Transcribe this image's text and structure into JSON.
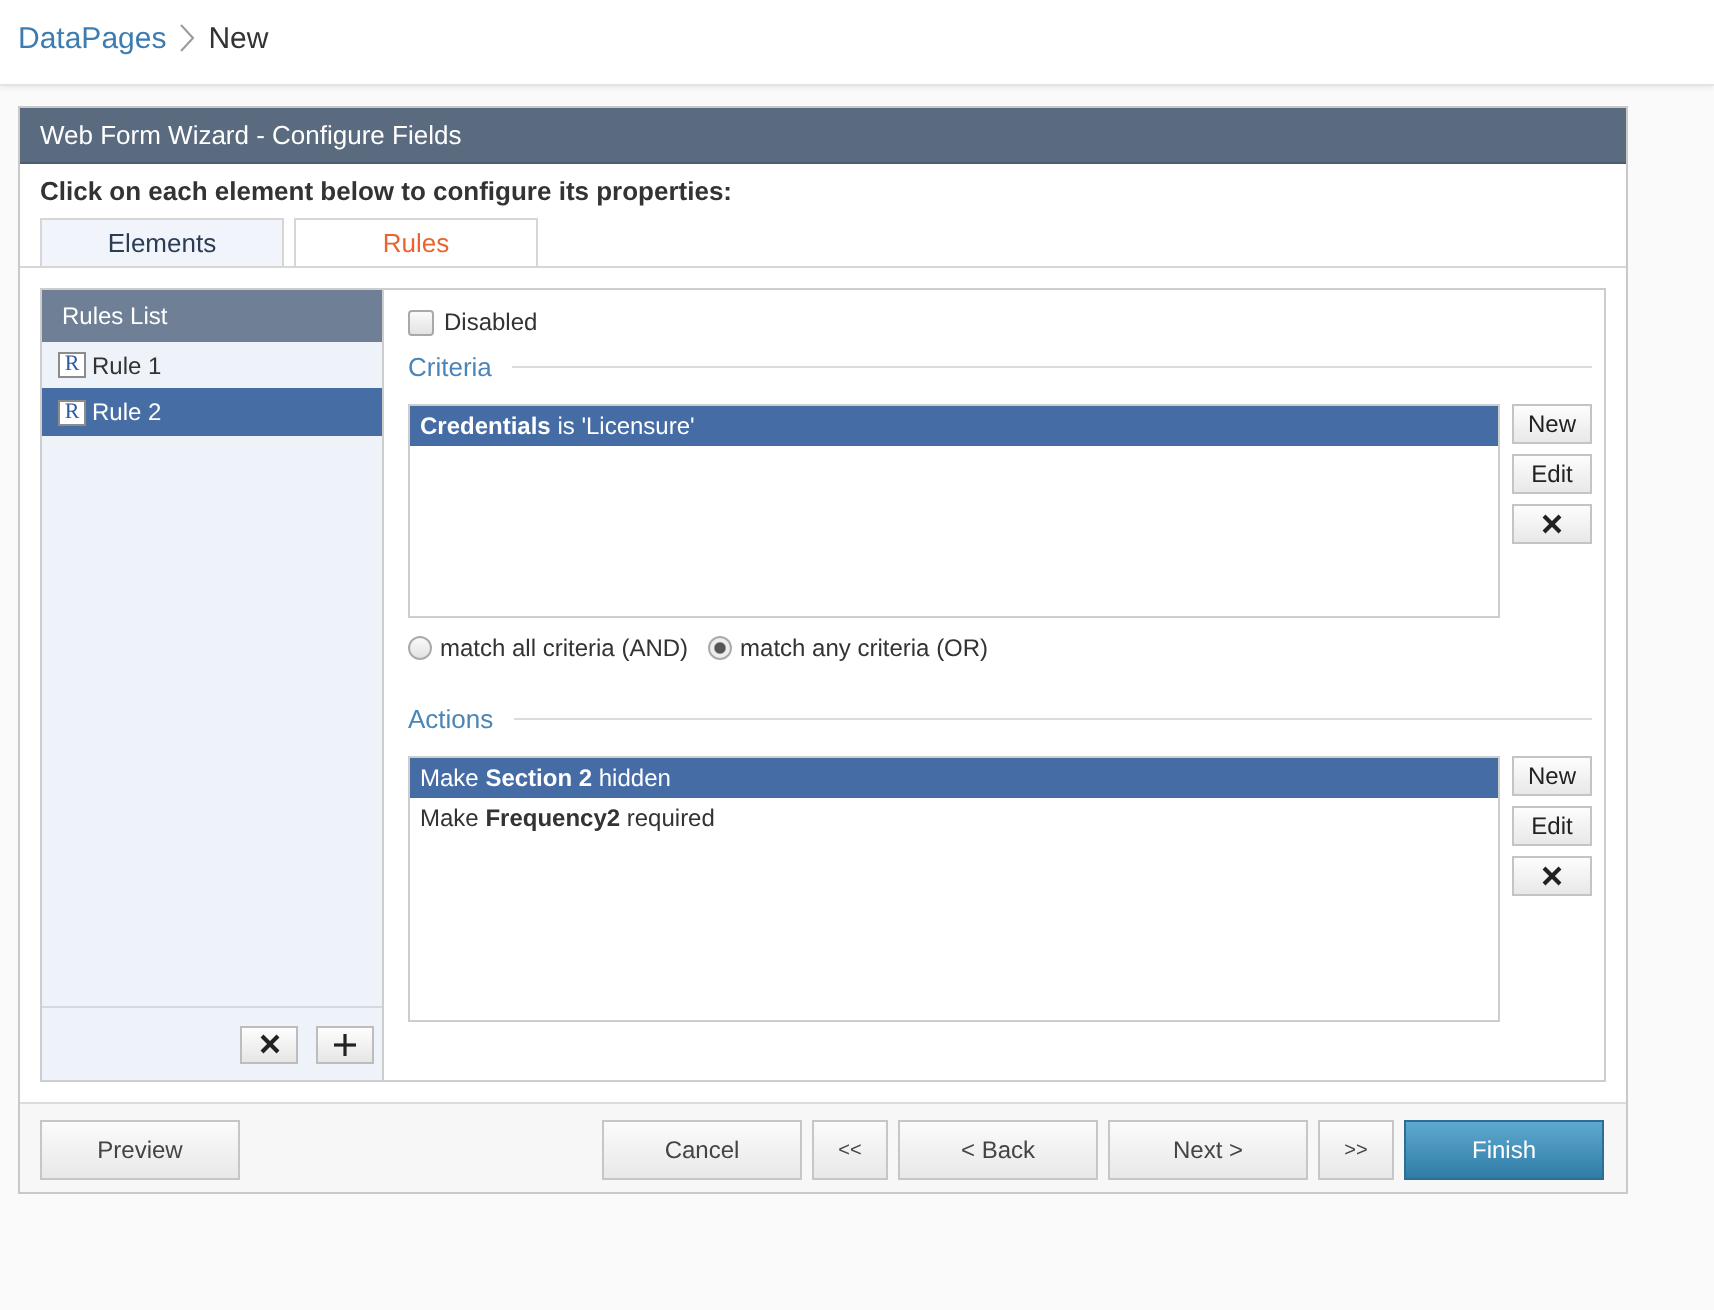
{
  "breadcrumb": [
    {
      "kind": "link",
      "label": "DataPages"
    },
    {
      "kind": "current",
      "label": "New"
    }
  ],
  "dialog": {
    "title": "Web Form Wizard - Configure Fields",
    "instruction": "Click on each element below to configure its properties:"
  },
  "tabs": [
    {
      "label": "Elements",
      "selected": false
    },
    {
      "label": "Rules",
      "selected": true
    }
  ],
  "rules_list": {
    "title": "Rules List",
    "items": [
      {
        "icon": "R",
        "label": "Rule 1",
        "selected": false
      },
      {
        "icon": "R",
        "label": "Rule 2",
        "selected": true
      }
    ],
    "buttons": [
      {
        "kind": "delete"
      },
      {
        "kind": "add"
      }
    ]
  },
  "rule_editor": {
    "disabled": {
      "label": "Disabled",
      "checked": false
    },
    "criteria": {
      "title": "Criteria",
      "items": [
        {
          "text": "**Credentials** is 'Licensure'",
          "selected": true
        }
      ],
      "buttons": [
        {
          "kind": "new",
          "label": "New"
        },
        {
          "kind": "edit",
          "label": "Edit"
        },
        {
          "kind": "delete"
        }
      ]
    },
    "match_options": [
      {
        "label": "match all criteria (AND)",
        "selected": false
      },
      {
        "label": "match any criteria (OR)",
        "selected": true
      }
    ],
    "actions": {
      "title": "Actions",
      "items": [
        {
          "text": "Make **Section 2** hidden",
          "selected": true
        },
        {
          "text": "Make **Frequency2** required",
          "selected": false
        }
      ],
      "buttons": [
        {
          "kind": "new",
          "label": "New"
        },
        {
          "kind": "edit",
          "label": "Edit"
        },
        {
          "kind": "delete"
        }
      ]
    }
  },
  "footer": {
    "buttons": [
      {
        "kind": "preview",
        "label": "Preview"
      },
      {
        "kind": "cancel",
        "label": "Cancel"
      },
      {
        "kind": "first",
        "label": "<<"
      },
      {
        "kind": "back",
        "label": "< Back"
      },
      {
        "kind": "next",
        "label": "Next >"
      },
      {
        "kind": "last",
        "label": ">>"
      },
      {
        "kind": "finish",
        "label": "Finish"
      }
    ]
  }
}
